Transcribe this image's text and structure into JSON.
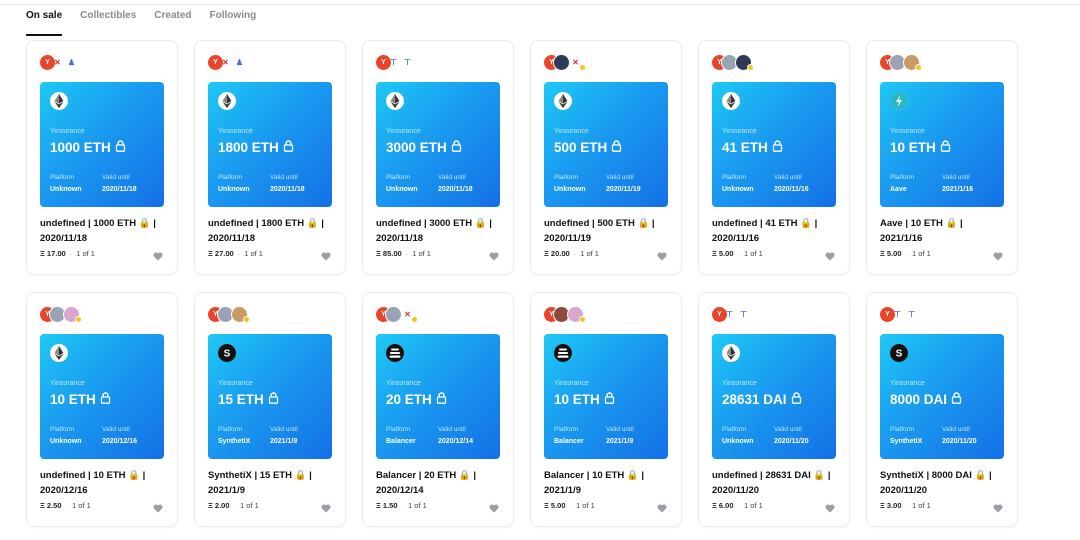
{
  "tabs": [
    {
      "label": "On sale",
      "active": true
    },
    {
      "label": "Collectibles",
      "active": false
    },
    {
      "label": "Created",
      "active": false
    },
    {
      "label": "Following",
      "active": false
    }
  ],
  "art_brand": "Yinsurance",
  "platform_label": "Platform",
  "valid_label": "Valid until",
  "avatar_letter": "Y",
  "colors": {
    "art_gradient_start": "#1ec8f5",
    "art_gradient_end": "#1470e6",
    "avatar_red": "#e8452b"
  },
  "cards": [
    {
      "coin": "eth-icon",
      "amount": "1000 ETH",
      "platform": "Unknown",
      "valid": "2020/11/18",
      "title_l1": "undefined | 1000 ETH 🔒 |",
      "title_l2": "2020/11/18",
      "price": "Ξ 17.00",
      "edition": "1 of 1",
      "avatars": [
        "red-mark",
        "purple-mark"
      ]
    },
    {
      "coin": "eth-icon",
      "amount": "1800 ETH",
      "platform": "Unknown",
      "valid": "2020/11/18",
      "title_l1": "undefined | 1800 ETH 🔒 |",
      "title_l2": "2020/11/18",
      "price": "Ξ 27.00",
      "edition": "1 of 1",
      "avatars": [
        "red-mark",
        "purple-mark"
      ]
    },
    {
      "coin": "eth-icon",
      "amount": "3000 ETH",
      "platform": "Unknown",
      "valid": "2020/11/18",
      "title_l1": "undefined | 3000 ETH 🔒 |",
      "title_l2": "2020/11/18",
      "price": "Ξ 85.00",
      "edition": "1 of 1",
      "avatars": [
        "blue-mark",
        "blue-mark"
      ]
    },
    {
      "coin": "eth-icon",
      "amount": "500 ETH",
      "platform": "Unknown",
      "valid": "2020/11/19",
      "title_l1": "undefined | 500 ETH 🔒 |",
      "title_l2": "2020/11/19",
      "price": "Ξ 20.00",
      "edition": "1 of 1",
      "avatars": [
        "dark-photo",
        "red-mark"
      ]
    },
    {
      "coin": "eth-icon",
      "amount": "41 ETH",
      "platform": "Unknown",
      "valid": "2020/11/16",
      "title_l1": "undefined | 41 ETH 🔒 |",
      "title_l2": "2020/11/16",
      "price": "Ξ 5.00",
      "edition": "1 of 1",
      "avatars": [
        "grey-photo",
        "dark-photo"
      ]
    },
    {
      "coin": "aave-icon",
      "amount": "10 ETH",
      "platform": "Aave",
      "valid": "2021/1/16",
      "title_l1": "Aave | 10 ETH 🔒 |",
      "title_l2": "2021/1/16",
      "price": "Ξ 5.00",
      "edition": "1 of 1",
      "avatars": [
        "grey-photo",
        "tan-photo"
      ]
    },
    {
      "coin": "eth-icon",
      "amount": "10 ETH",
      "platform": "Unknown",
      "valid": "2020/12/16",
      "title_l1": "undefined | 10 ETH 🔒 |",
      "title_l2": "2020/12/16",
      "price": "Ξ 2.50",
      "edition": "1 of 1",
      "avatars": [
        "grey-photo",
        "pink-photo"
      ]
    },
    {
      "coin": "synthetix-icon",
      "amount": "15 ETH",
      "platform": "SynthetiX",
      "valid": "2021/1/9",
      "title_l1": "SynthetiX | 15 ETH 🔒 |",
      "title_l2": "2021/1/9",
      "price": "Ξ 2.00",
      "edition": "1 of 1",
      "avatars": [
        "grey-photo",
        "tan-photo"
      ]
    },
    {
      "coin": "balancer-icon",
      "amount": "20 ETH",
      "platform": "Balancer",
      "valid": "2020/12/14",
      "title_l1": "Balancer | 20 ETH 🔒 |",
      "title_l2": "2020/12/14",
      "price": "Ξ 1.50",
      "edition": "1 of 1",
      "avatars": [
        "grey-photo",
        "red-mark"
      ]
    },
    {
      "coin": "balancer-icon",
      "amount": "10 ETH",
      "platform": "Balancer",
      "valid": "2021/1/9",
      "title_l1": "Balancer | 10 ETH 🔒 |",
      "title_l2": "2021/1/9",
      "price": "Ξ 5.00",
      "edition": "1 of 1",
      "avatars": [
        "brown-photo",
        "pink-photo"
      ]
    },
    {
      "coin": "eth-icon",
      "amount": "28631 DAI",
      "platform": "Unknown",
      "valid": "2020/11/20",
      "title_l1": "undefined | 28631 DAI 🔒 |",
      "title_l2": "2020/11/20",
      "price": "Ξ 6.00",
      "edition": "1 of 1",
      "avatars": [
        "blue-mark",
        "blue-mark"
      ]
    },
    {
      "coin": "synthetix-icon",
      "amount": "8000 DAI",
      "platform": "SynthetiX",
      "valid": "2020/11/20",
      "title_l1": "SynthetiX | 8000 DAI 🔒 |",
      "title_l2": "2020/11/20",
      "price": "Ξ 3.00",
      "edition": "1 of 1",
      "avatars": [
        "blue-mark",
        "blue-mark"
      ]
    }
  ]
}
